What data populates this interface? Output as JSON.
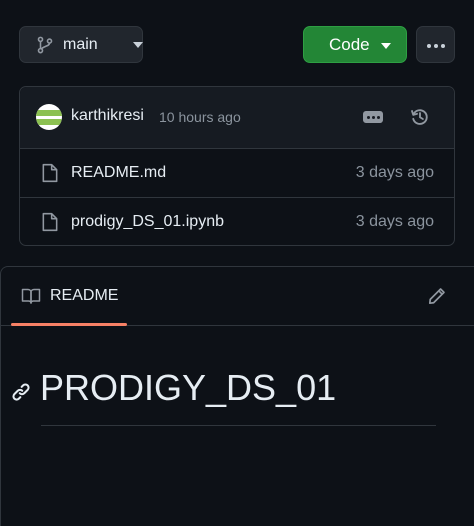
{
  "branch": {
    "name": "main",
    "icon": "git-branch-icon"
  },
  "code_button": {
    "label": "Code",
    "color": "#238636"
  },
  "more_button": {
    "icon": "kebab-horizontal-icon"
  },
  "latest_commit": {
    "author": "karthikresi",
    "time": "10 hours ago",
    "message_toggle_icon": "ellipsis-icon",
    "history_icon": "history-icon"
  },
  "files": [
    {
      "name": "README.md",
      "date": "3 days ago",
      "icon": "file-icon"
    },
    {
      "name": "prodigy_DS_01.ipynb",
      "date": "3 days ago",
      "icon": "file-icon"
    }
  ],
  "readme": {
    "tab_label": "README",
    "tab_icon": "book-icon",
    "edit_icon": "pencil-icon",
    "heading": "PRODIGY_DS_01",
    "heading_anchor_icon": "link-icon",
    "accent_color": "#f78166"
  }
}
